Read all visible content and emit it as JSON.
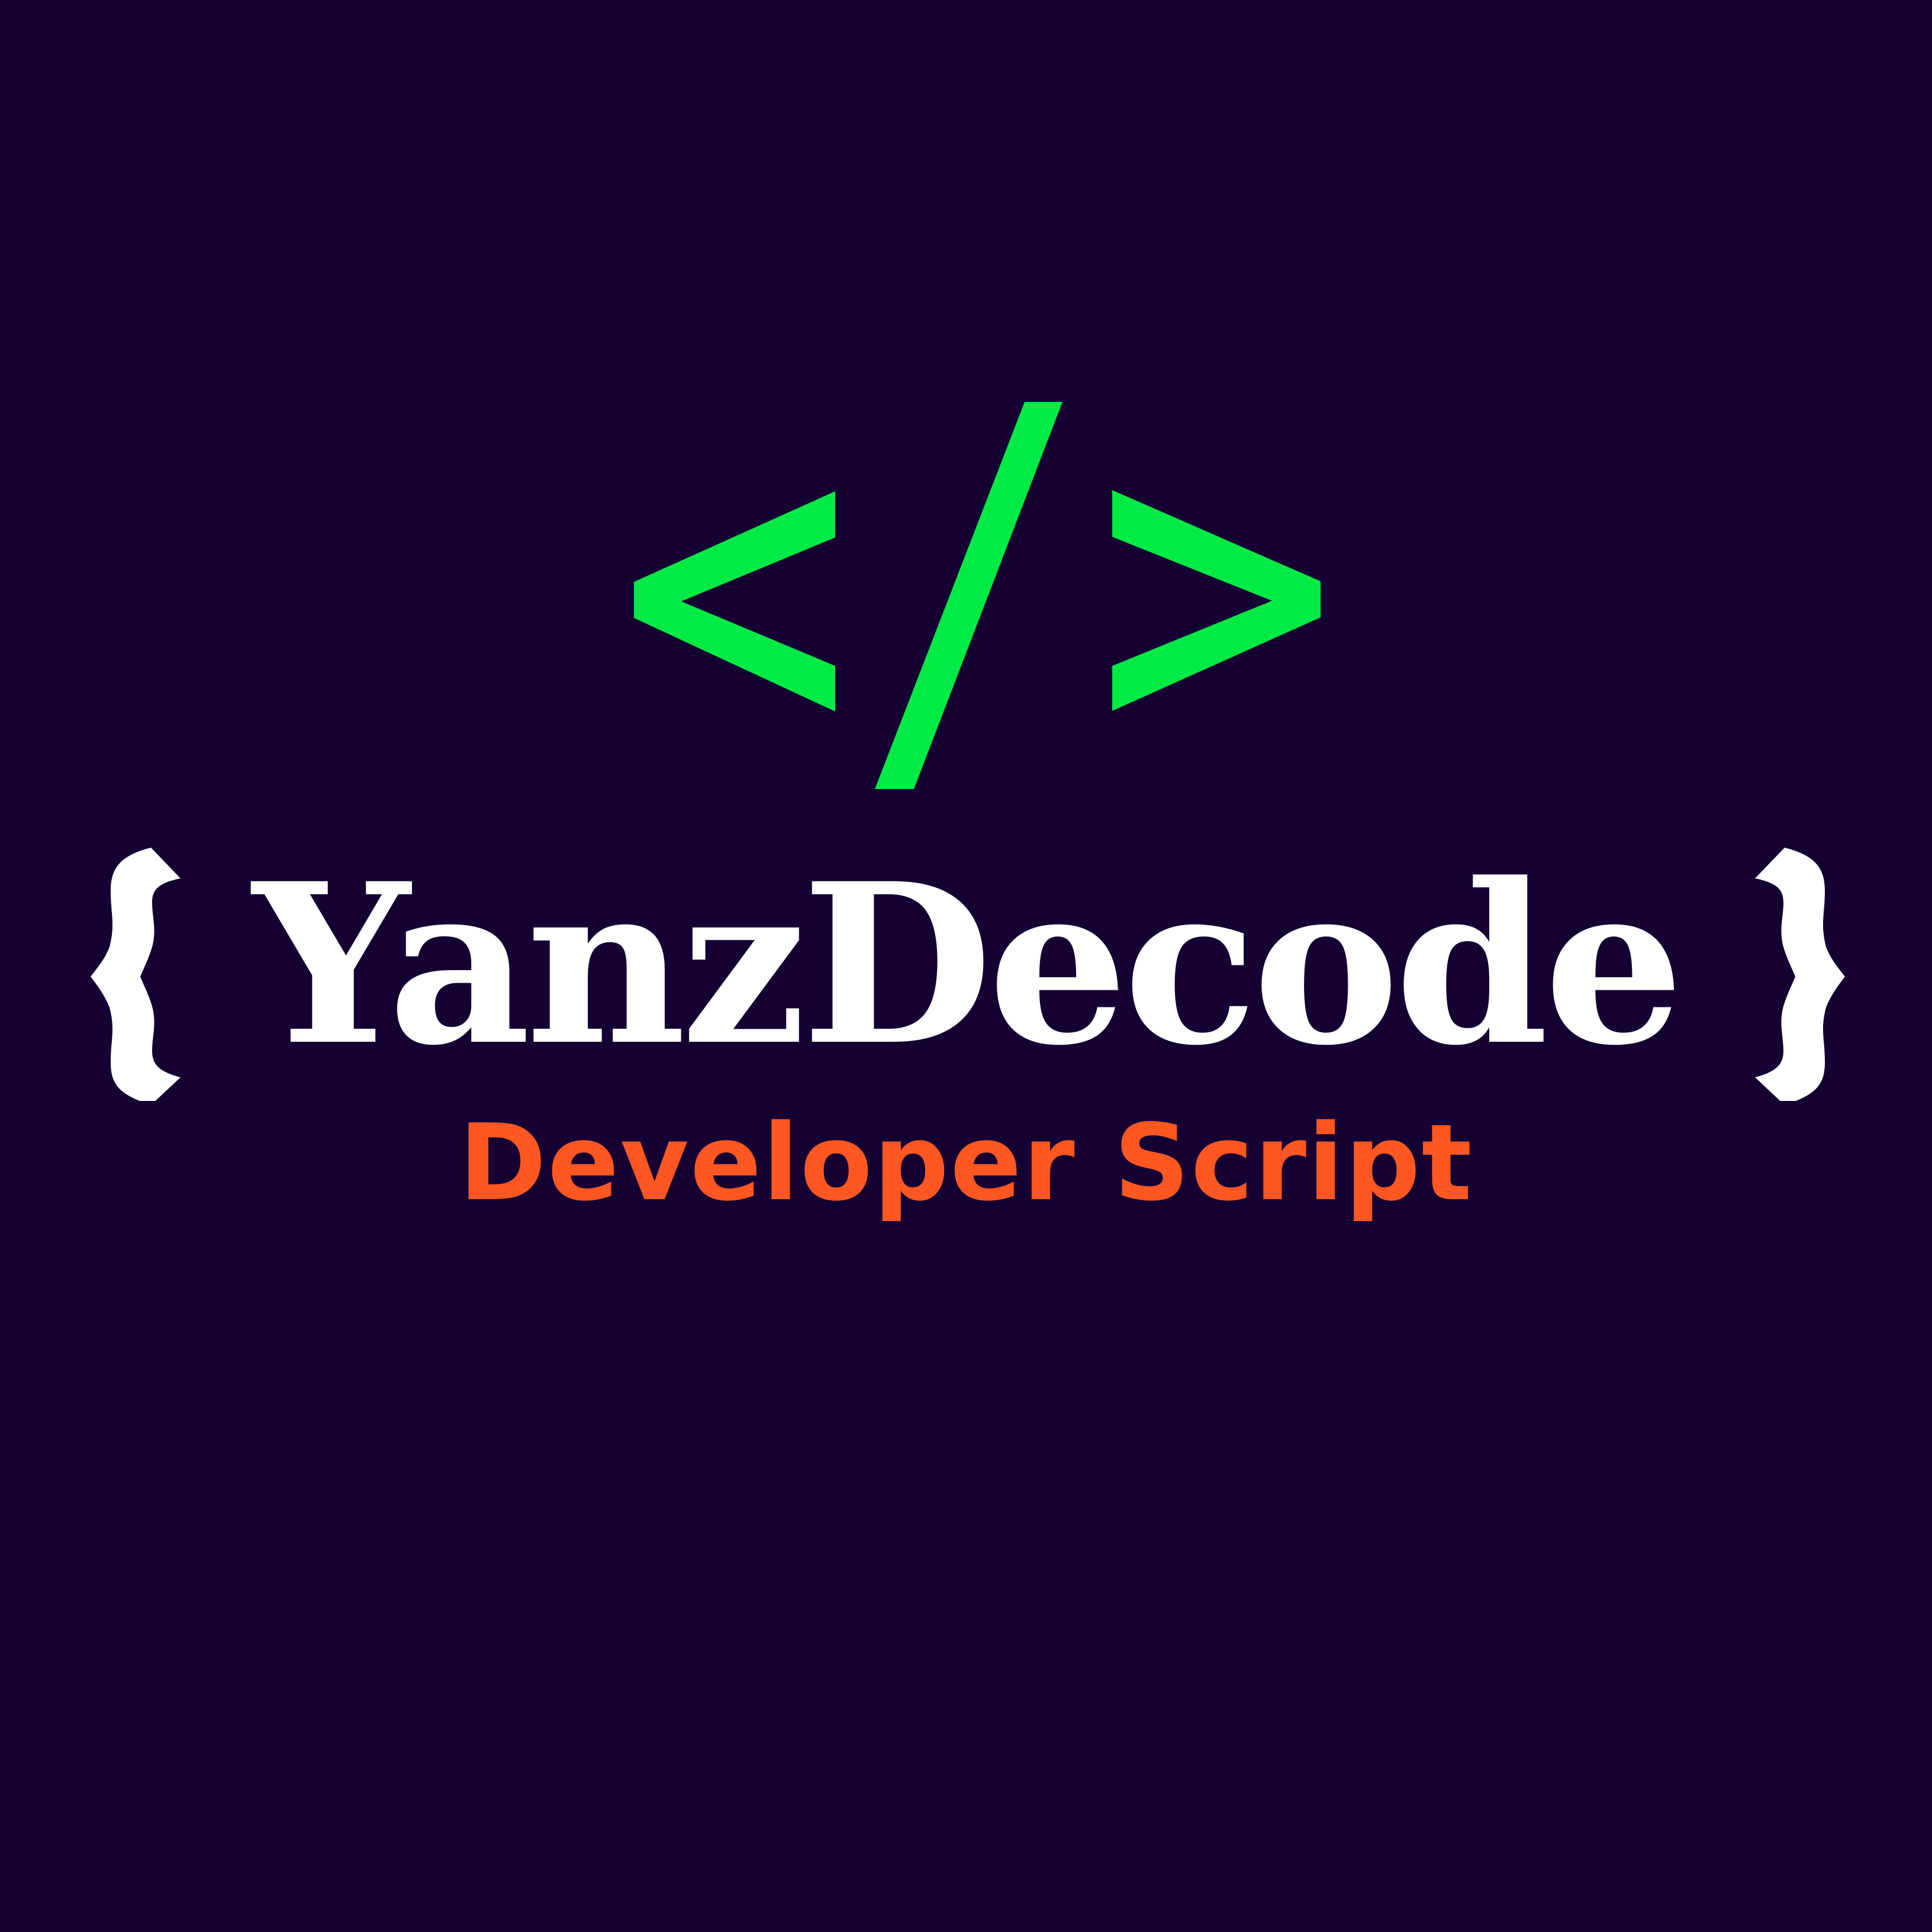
{
  "logo": {
    "icon": "code-slash-icon",
    "brand_name": "YanzDecode",
    "tagline": "Developer Script",
    "colors": {
      "background": "#150033",
      "icon": "#00ea45",
      "brand_name": "#ffffff",
      "tagline": "#ff5722"
    }
  }
}
